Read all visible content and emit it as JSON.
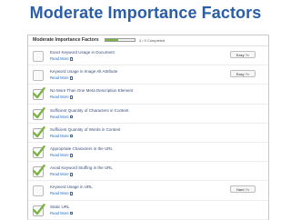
{
  "slide_title": "Moderate Importance Factors",
  "panel": {
    "title": "Moderate Importance Factors",
    "progress_text": "4 / 9 Completed",
    "progress_fraction": 0.44
  },
  "read_more_label": "Read More",
  "items": [
    {
      "label": "Exact Keyword Usage in Document",
      "checked": false,
      "button": "Easy ?>"
    },
    {
      "label": "Keyword Usage in Image Alt Attribute",
      "checked": false,
      "button": "Easy ?>"
    },
    {
      "label": "No More Than One Meta Description Element",
      "checked": true,
      "button": ""
    },
    {
      "label": "Sufficient Quantity of Characters in Content",
      "checked": true,
      "button": ""
    },
    {
      "label": "Sufficient Quantity of Words in Content",
      "checked": true,
      "button": ""
    },
    {
      "label": "Appropriate Characters in the URL",
      "checked": true,
      "button": ""
    },
    {
      "label": "Avoid Keyword Stuffing in the URL",
      "checked": true,
      "button": ""
    },
    {
      "label": "Keyword Usage in URL",
      "checked": false,
      "button": "Hard ?>"
    },
    {
      "label": "Static URL",
      "checked": true,
      "button": ""
    }
  ],
  "colors": {
    "check": "#7cb342",
    "title": "#2a5ea8",
    "link": "#2a6fbf"
  }
}
